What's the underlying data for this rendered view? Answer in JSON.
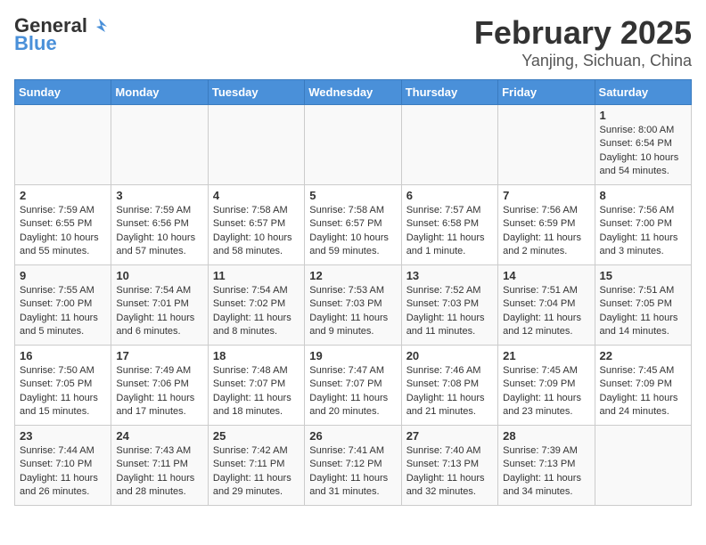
{
  "header": {
    "logo_general": "General",
    "logo_blue": "Blue",
    "month_year": "February 2025",
    "location": "Yanjing, Sichuan, China"
  },
  "weekdays": [
    "Sunday",
    "Monday",
    "Tuesday",
    "Wednesday",
    "Thursday",
    "Friday",
    "Saturday"
  ],
  "weeks": [
    [
      {
        "day": "",
        "info": ""
      },
      {
        "day": "",
        "info": ""
      },
      {
        "day": "",
        "info": ""
      },
      {
        "day": "",
        "info": ""
      },
      {
        "day": "",
        "info": ""
      },
      {
        "day": "",
        "info": ""
      },
      {
        "day": "1",
        "info": "Sunrise: 8:00 AM\nSunset: 6:54 PM\nDaylight: 10 hours\nand 54 minutes."
      }
    ],
    [
      {
        "day": "2",
        "info": "Sunrise: 7:59 AM\nSunset: 6:55 PM\nDaylight: 10 hours\nand 55 minutes."
      },
      {
        "day": "3",
        "info": "Sunrise: 7:59 AM\nSunset: 6:56 PM\nDaylight: 10 hours\nand 57 minutes."
      },
      {
        "day": "4",
        "info": "Sunrise: 7:58 AM\nSunset: 6:57 PM\nDaylight: 10 hours\nand 58 minutes."
      },
      {
        "day": "5",
        "info": "Sunrise: 7:58 AM\nSunset: 6:57 PM\nDaylight: 10 hours\nand 59 minutes."
      },
      {
        "day": "6",
        "info": "Sunrise: 7:57 AM\nSunset: 6:58 PM\nDaylight: 11 hours\nand 1 minute."
      },
      {
        "day": "7",
        "info": "Sunrise: 7:56 AM\nSunset: 6:59 PM\nDaylight: 11 hours\nand 2 minutes."
      },
      {
        "day": "8",
        "info": "Sunrise: 7:56 AM\nSunset: 7:00 PM\nDaylight: 11 hours\nand 3 minutes."
      }
    ],
    [
      {
        "day": "9",
        "info": "Sunrise: 7:55 AM\nSunset: 7:00 PM\nDaylight: 11 hours\nand 5 minutes."
      },
      {
        "day": "10",
        "info": "Sunrise: 7:54 AM\nSunset: 7:01 PM\nDaylight: 11 hours\nand 6 minutes."
      },
      {
        "day": "11",
        "info": "Sunrise: 7:54 AM\nSunset: 7:02 PM\nDaylight: 11 hours\nand 8 minutes."
      },
      {
        "day": "12",
        "info": "Sunrise: 7:53 AM\nSunset: 7:03 PM\nDaylight: 11 hours\nand 9 minutes."
      },
      {
        "day": "13",
        "info": "Sunrise: 7:52 AM\nSunset: 7:03 PM\nDaylight: 11 hours\nand 11 minutes."
      },
      {
        "day": "14",
        "info": "Sunrise: 7:51 AM\nSunset: 7:04 PM\nDaylight: 11 hours\nand 12 minutes."
      },
      {
        "day": "15",
        "info": "Sunrise: 7:51 AM\nSunset: 7:05 PM\nDaylight: 11 hours\nand 14 minutes."
      }
    ],
    [
      {
        "day": "16",
        "info": "Sunrise: 7:50 AM\nSunset: 7:05 PM\nDaylight: 11 hours\nand 15 minutes."
      },
      {
        "day": "17",
        "info": "Sunrise: 7:49 AM\nSunset: 7:06 PM\nDaylight: 11 hours\nand 17 minutes."
      },
      {
        "day": "18",
        "info": "Sunrise: 7:48 AM\nSunset: 7:07 PM\nDaylight: 11 hours\nand 18 minutes."
      },
      {
        "day": "19",
        "info": "Sunrise: 7:47 AM\nSunset: 7:07 PM\nDaylight: 11 hours\nand 20 minutes."
      },
      {
        "day": "20",
        "info": "Sunrise: 7:46 AM\nSunset: 7:08 PM\nDaylight: 11 hours\nand 21 minutes."
      },
      {
        "day": "21",
        "info": "Sunrise: 7:45 AM\nSunset: 7:09 PM\nDaylight: 11 hours\nand 23 minutes."
      },
      {
        "day": "22",
        "info": "Sunrise: 7:45 AM\nSunset: 7:09 PM\nDaylight: 11 hours\nand 24 minutes."
      }
    ],
    [
      {
        "day": "23",
        "info": "Sunrise: 7:44 AM\nSunset: 7:10 PM\nDaylight: 11 hours\nand 26 minutes."
      },
      {
        "day": "24",
        "info": "Sunrise: 7:43 AM\nSunset: 7:11 PM\nDaylight: 11 hours\nand 28 minutes."
      },
      {
        "day": "25",
        "info": "Sunrise: 7:42 AM\nSunset: 7:11 PM\nDaylight: 11 hours\nand 29 minutes."
      },
      {
        "day": "26",
        "info": "Sunrise: 7:41 AM\nSunset: 7:12 PM\nDaylight: 11 hours\nand 31 minutes."
      },
      {
        "day": "27",
        "info": "Sunrise: 7:40 AM\nSunset: 7:13 PM\nDaylight: 11 hours\nand 32 minutes."
      },
      {
        "day": "28",
        "info": "Sunrise: 7:39 AM\nSunset: 7:13 PM\nDaylight: 11 hours\nand 34 minutes."
      },
      {
        "day": "",
        "info": ""
      }
    ]
  ]
}
